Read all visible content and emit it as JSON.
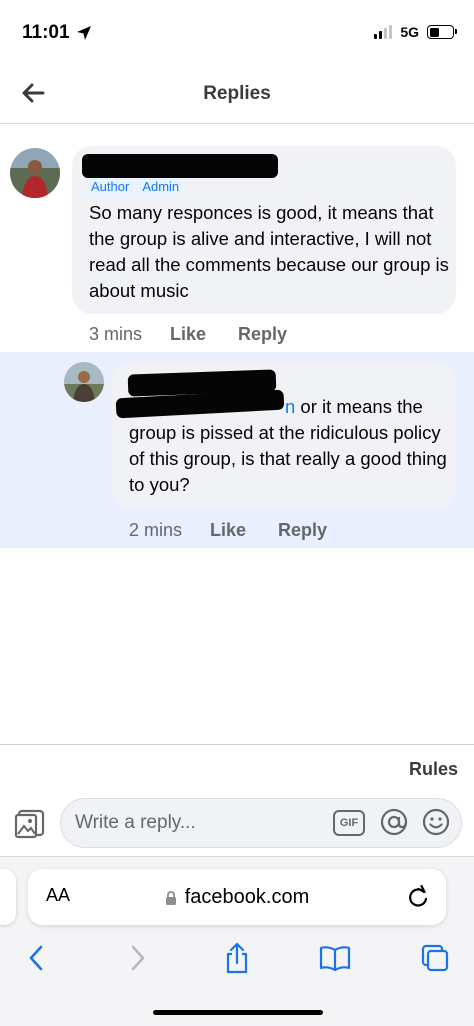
{
  "status_bar": {
    "time": "11:01",
    "network": "5G"
  },
  "header": {
    "title": "Replies"
  },
  "comments": [
    {
      "author": "[redacted]",
      "badges": [
        "Author",
        "Admin"
      ],
      "text": "So many responces is good, it means that the group is alive and interactive, I will not read all the comments because our group is about music",
      "time": "3 mins",
      "like_label": "Like",
      "reply_label": "Reply"
    },
    {
      "author": "[redacted]",
      "mention": "n",
      "text": " or it means the group is pissed at the ridiculous policy of this group, is that really a good thing to you?",
      "time": "2 mins",
      "like_label": "Like",
      "reply_label": "Reply",
      "highlighted": true
    }
  ],
  "composer": {
    "rules_label": "Rules",
    "placeholder": "Write a reply...",
    "gif_label": "GIF"
  },
  "browser": {
    "aa_label": "AA",
    "url": "facebook.com"
  },
  "colors": {
    "accent": "#1877f2",
    "bubble": "#f0f2f5",
    "highlight": "#e9effd"
  }
}
